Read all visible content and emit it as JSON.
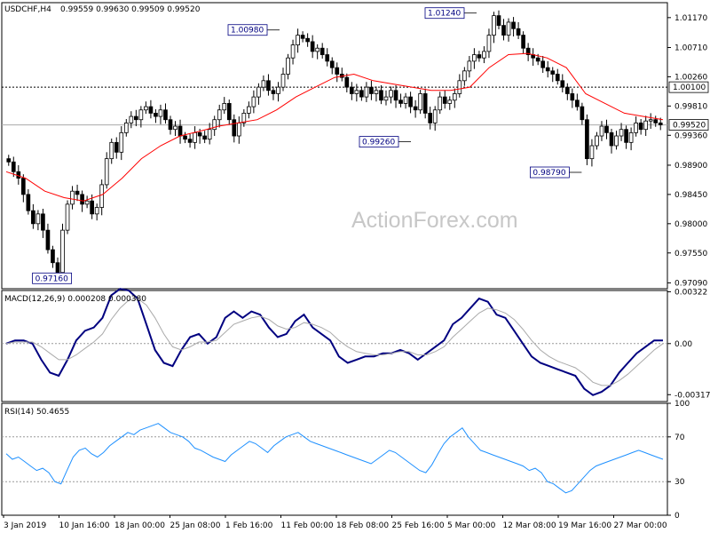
{
  "chart_data": {
    "type": "candlestick",
    "symbol_header": "USDCHF,H4",
    "ohlc_header": "0.99559 0.99630 0.99509 0.99520",
    "watermark": "ActionForex.com",
    "x_labels": [
      "3 Jan 2019",
      "10 Jan 16:00",
      "18 Jan 00:00",
      "25 Jan 08:00",
      "1 Feb 16:00",
      "11 Feb 00:00",
      "18 Feb 08:00",
      "25 Feb 16:00",
      "5 Mar 00:00",
      "12 Mar 08:00",
      "19 Mar 16:00",
      "27 Mar 00:00"
    ],
    "price_panel": {
      "ylim": [
        0.97,
        1.014
      ],
      "y_ticks": [
        "1.01170",
        "1.00710",
        "1.00260",
        "0.99810",
        "0.99360",
        "0.98900",
        "0.98450",
        "0.98000",
        "0.97550",
        "0.97090"
      ],
      "y_tick_values": [
        1.0117,
        1.0071,
        1.0026,
        0.9981,
        0.9936,
        0.989,
        0.9845,
        0.98,
        0.9755,
        0.9709
      ],
      "resistance_label": "1.00100",
      "resistance_value": 1.001,
      "current_label": "0.99520",
      "current_value": 0.9952,
      "annotations": [
        {
          "text": "0.97160",
          "value": 0.9716
        },
        {
          "text": "1.00980",
          "value": 1.0098
        },
        {
          "text": "0.99260",
          "value": 0.9926
        },
        {
          "text": "1.01240",
          "value": 1.0124
        },
        {
          "text": "0.98790",
          "value": 0.9879
        }
      ],
      "close": [
        0.9895,
        0.988,
        0.987,
        0.9845,
        0.982,
        0.98,
        0.9815,
        0.979,
        0.976,
        0.974,
        0.9725,
        0.979,
        0.983,
        0.985,
        0.9845,
        0.983,
        0.9835,
        0.9815,
        0.9825,
        0.986,
        0.99,
        0.9925,
        0.991,
        0.994,
        0.9955,
        0.9965,
        0.996,
        0.9975,
        0.998,
        0.997,
        0.9965,
        0.9975,
        0.996,
        0.9945,
        0.995,
        0.9935,
        0.993,
        0.9925,
        0.994,
        0.9935,
        0.993,
        0.9945,
        0.996,
        0.9975,
        0.9985,
        0.996,
        0.9935,
        0.9955,
        0.997,
        0.998,
        0.9995,
        1.001,
        1.002,
        1.0005,
        1.0,
        1.001,
        1.003,
        1.0055,
        1.0075,
        1.009,
        1.0085,
        1.008,
        1.0065,
        1.007,
        1.006,
        1.005,
        1.004,
        1.003,
        1.0025,
        1.001,
        1.0,
        1.0005,
        0.9995,
        1.001,
        1.0,
        1.0005,
        0.999,
        0.9995,
        1.0005,
        0.999,
        0.9985,
        0.9995,
        0.998,
        0.9975,
        1.0,
        0.997,
        0.9955,
        0.9975,
        0.9995,
        0.9985,
        0.999,
        1.0,
        1.002,
        1.0035,
        1.005,
        1.006,
        1.0055,
        1.0065,
        1.009,
        1.012,
        1.0105,
        1.009,
        1.011,
        1.01,
        1.009,
        1.007,
        1.006,
        1.0055,
        1.005,
        1.004,
        1.0035,
        1.003,
        1.002,
        1.001,
        1.0,
        0.999,
        0.998,
        0.996,
        0.99,
        0.992,
        0.9935,
        0.995,
        0.994,
        0.992,
        0.9935,
        0.9945,
        0.9925,
        0.994,
        0.9955,
        0.9945,
        0.9958,
        0.996,
        0.9955,
        0.9952
      ],
      "ma_values": [
        0.988,
        0.987,
        0.985,
        0.984,
        0.9835,
        0.9845,
        0.987,
        0.99,
        0.992,
        0.9935,
        0.9942,
        0.995,
        0.9955,
        0.996,
        0.9975,
        0.9995,
        1.001,
        1.0025,
        1.003,
        1.002,
        1.0015,
        1.001,
        1.0005,
        1.0005,
        1.001,
        1.004,
        1.006,
        1.0062,
        1.0055,
        1.004,
        1.0,
        0.9985,
        0.997,
        0.9965,
        0.996
      ]
    },
    "macd_panel": {
      "label": "MACD(12,26,9) 0.000208 0.000380",
      "y_ticks": [
        "0.00322",
        "0.00",
        "-0.003174"
      ],
      "y_tick_values": [
        0.00322,
        0.0,
        -0.003174
      ],
      "ylim": [
        -0.0036,
        0.0033
      ],
      "macd": [
        0.0,
        0.0002,
        0.0002,
        0.0,
        -0.001,
        -0.0018,
        -0.002,
        -0.001,
        0.0002,
        0.0008,
        0.001,
        0.0016,
        0.003,
        0.0034,
        0.0033,
        0.0028,
        0.0012,
        -0.0004,
        -0.0012,
        -0.0014,
        -0.0004,
        0.0004,
        0.0006,
        0.0,
        0.0004,
        0.0016,
        0.002,
        0.0016,
        0.002,
        0.0018,
        0.001,
        0.0004,
        0.0006,
        0.0014,
        0.0018,
        0.001,
        0.0006,
        0.0002,
        -0.0008,
        -0.0012,
        -0.001,
        -0.0008,
        -0.0008,
        -0.0006,
        -0.0006,
        -0.0004,
        -0.0006,
        -0.001,
        -0.0006,
        -0.0002,
        0.0002,
        0.0012,
        0.0016,
        0.0022,
        0.0028,
        0.0026,
        0.0018,
        0.0016,
        0.0008,
        0.0,
        -0.0008,
        -0.0012,
        -0.0014,
        -0.0016,
        -0.0018,
        -0.002,
        -0.0028,
        -0.0032,
        -0.003,
        -0.0026,
        -0.0018,
        -0.0012,
        -0.0006,
        -0.0002,
        0.0002,
        0.0002
      ],
      "signal": [
        0.0,
        0.0001,
        0.0001,
        0.0001,
        -0.0002,
        -0.0006,
        -0.001,
        -0.001,
        -0.0007,
        -0.0003,
        0.0001,
        0.0006,
        0.0015,
        0.0022,
        0.0027,
        0.0028,
        0.0024,
        0.0016,
        0.0006,
        -0.0002,
        -0.0004,
        -0.0002,
        0.0001,
        0.0001,
        0.0002,
        0.0007,
        0.0012,
        0.0014,
        0.0016,
        0.0017,
        0.0015,
        0.0011,
        0.0009,
        0.001,
        0.0013,
        0.0012,
        0.001,
        0.0007,
        0.0002,
        -0.0002,
        -0.0005,
        -0.0006,
        -0.0007,
        -0.0007,
        -0.0006,
        -0.0005,
        -0.0005,
        -0.0007,
        -0.0007,
        -0.0005,
        -0.0002,
        0.0004,
        0.0009,
        0.0014,
        0.0019,
        0.0022,
        0.0021,
        0.0019,
        0.0015,
        0.0009,
        0.0002,
        -0.0004,
        -0.0008,
        -0.0011,
        -0.0013,
        -0.0015,
        -0.0019,
        -0.0024,
        -0.0026,
        -0.0026,
        -0.0023,
        -0.0019,
        -0.0014,
        -0.0009,
        -0.0004,
        0.0
      ]
    },
    "rsi_panel": {
      "label": "RSI(14) 50.4655",
      "y_ticks": [
        "100",
        "70",
        "30",
        "0"
      ],
      "y_tick_values": [
        100,
        70,
        30,
        0
      ],
      "levels": [
        70,
        30
      ],
      "values": [
        55,
        50,
        52,
        48,
        44,
        40,
        42,
        38,
        30,
        28,
        40,
        52,
        58,
        60,
        55,
        52,
        56,
        62,
        66,
        70,
        74,
        72,
        76,
        78,
        80,
        82,
        78,
        74,
        72,
        70,
        66,
        60,
        58,
        55,
        52,
        50,
        48,
        54,
        58,
        62,
        66,
        64,
        60,
        56,
        62,
        66,
        70,
        72,
        74,
        70,
        66,
        64,
        62,
        60,
        58,
        56,
        54,
        52,
        50,
        48,
        46,
        50,
        54,
        58,
        56,
        52,
        48,
        44,
        40,
        38,
        45,
        55,
        64,
        70,
        74,
        78,
        70,
        64,
        58,
        56,
        54,
        52,
        50,
        48,
        46,
        44,
        40,
        42,
        38,
        30,
        28,
        24,
        20,
        22,
        28,
        34,
        40,
        44,
        46,
        48,
        50,
        52,
        54,
        56,
        58,
        56,
        54,
        52,
        50
      ]
    }
  }
}
